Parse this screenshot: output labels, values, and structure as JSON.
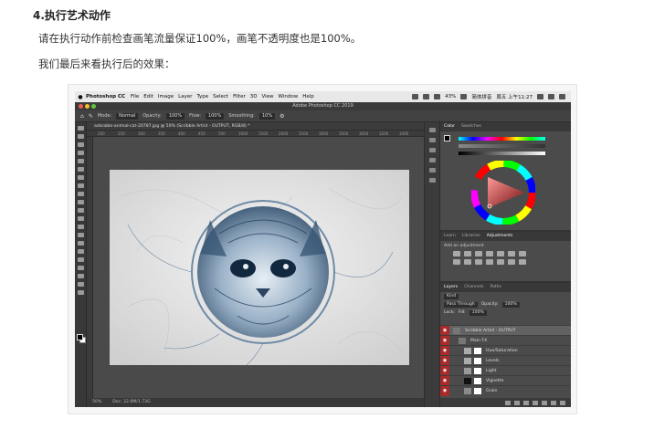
{
  "article": {
    "heading": "4.执行艺术动作",
    "para1": "请在执行动作前检查画笔流量保证100%，画笔不透明度也是100%。",
    "para2": "我们最后来看执行后的效果："
  },
  "screenshot": {
    "menubar": {
      "apple": "",
      "app": "Photoshop CC",
      "items": [
        "File",
        "Edit",
        "Image",
        "Layer",
        "Type",
        "Select",
        "Filter",
        "3D",
        "View",
        "Window",
        "Help"
      ],
      "battery": "43%",
      "input_method": "简体拼音",
      "clock": "周五 上午11:27"
    },
    "window_title": "Adobe Photoshop CC 2019",
    "options": {
      "mode_label": "Mode:",
      "mode_value": "Normal",
      "opacity_label": "Opacity:",
      "opacity_value": "100%",
      "flow_label": "Flow:",
      "flow_value": "100%",
      "smoothing_label": "Smoothing:",
      "smoothing_value": "10%"
    },
    "doc_tab": "adorable-animal-cat-20787.jpg @ 50% (Scribble Artist - OUTPUT, RGB/8) *",
    "ruler_ticks": [
      "200",
      "250",
      "300",
      "350",
      "400",
      "450",
      "500",
      "1000",
      "1500",
      "2000",
      "2500",
      "3000",
      "3500",
      "3000",
      "3200",
      "3400"
    ],
    "status": {
      "zoom": "50%",
      "doc_size": "Doc: 22.8M/1.73G"
    },
    "color_panel": {
      "tabs": [
        "Color",
        "Swatches"
      ]
    },
    "adjust_panel": {
      "tabs": [
        "Learn",
        "Libraries",
        "Adjustments"
      ],
      "label": "Add an adjustment"
    },
    "layers_panel": {
      "tabs": [
        "Layers",
        "Channels",
        "Paths"
      ],
      "kind": "Kind",
      "blend": "Pass Through",
      "opacity_label": "Opacity:",
      "opacity": "100%",
      "lock_label": "Lock:",
      "fill_label": "Fill:",
      "fill": "100%",
      "layers": [
        {
          "name": "Scribble Artist - OUTPUT"
        },
        {
          "name": "Main FX"
        },
        {
          "name": "Hue/Saturation"
        },
        {
          "name": "Levels"
        },
        {
          "name": "Light"
        },
        {
          "name": "Vignette"
        },
        {
          "name": "Grain"
        }
      ]
    }
  }
}
